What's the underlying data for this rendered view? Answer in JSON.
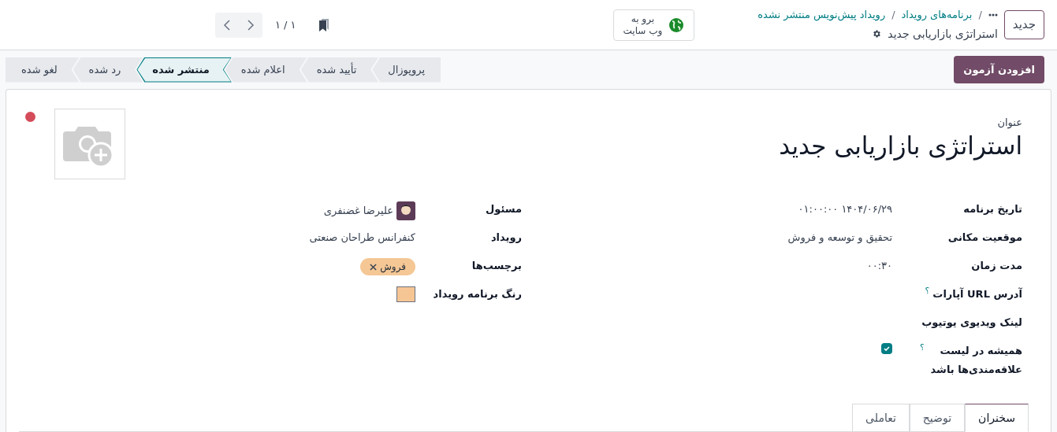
{
  "top_bar": {
    "new_button": "جدید",
    "breadcrumbs": [
      {
        "separator": "/",
        "label": "برنامه‌های رویداد"
      },
      {
        "separator": "/",
        "label": "رویداد پیش‌نویس منتشر نشده"
      }
    ],
    "record_title": "استراتژی بازاریابی جدید",
    "website_button": "برو به\nوب سایت",
    "pager": "۱ / ۱"
  },
  "action_button": "افزودن آزمون",
  "stages": [
    {
      "label": "پروپوزال",
      "selected": false
    },
    {
      "label": "تأیید شده",
      "selected": false
    },
    {
      "label": "اعلام شده",
      "selected": false
    },
    {
      "label": "منتشر شده",
      "selected": true
    },
    {
      "label": "رد شده",
      "selected": false
    },
    {
      "label": "لغو شده",
      "selected": false
    }
  ],
  "form": {
    "title_label": "عنوان",
    "title": "استراتژی بازاریابی جدید",
    "fields_right": [
      {
        "kind": "text",
        "label": "تاریخ برنامه",
        "value": "۱۴۰۴/۰۶/۲۹ ۰۱:۰۰:۰۰"
      },
      {
        "kind": "text",
        "label": "موقعیت مکانی",
        "value": "تحقیق و توسعه و فروش"
      },
      {
        "kind": "text",
        "label": "مدت زمان",
        "value": "۰۰:۳۰"
      },
      {
        "kind": "empty",
        "label": "آدرس URL آپارات",
        "help": "؟"
      },
      {
        "kind": "empty",
        "label": "لینک ویدیوی یوتیوب"
      },
      {
        "kind": "checkbox",
        "label": "همیشه در لیست علاقه‌مندی‌ها باشد",
        "help": "؟",
        "checked": true
      }
    ],
    "fields_left": [
      {
        "kind": "person",
        "label": "مسئول",
        "value": "علیرضا غضنفری"
      },
      {
        "kind": "text",
        "label": "رویداد",
        "value": "کنفرانس طراحان صنعتی"
      },
      {
        "kind": "tag",
        "label": "برچسب‌ها",
        "value": "فروش",
        "color": "#f4c795"
      },
      {
        "kind": "color",
        "label": "رنگ برنامه رویداد",
        "color": "#f6c594"
      }
    ]
  },
  "tabs": [
    {
      "label": "سخنران",
      "selected": true
    },
    {
      "label": "توضیح",
      "selected": false
    },
    {
      "label": "تعاملی",
      "selected": false
    }
  ]
}
